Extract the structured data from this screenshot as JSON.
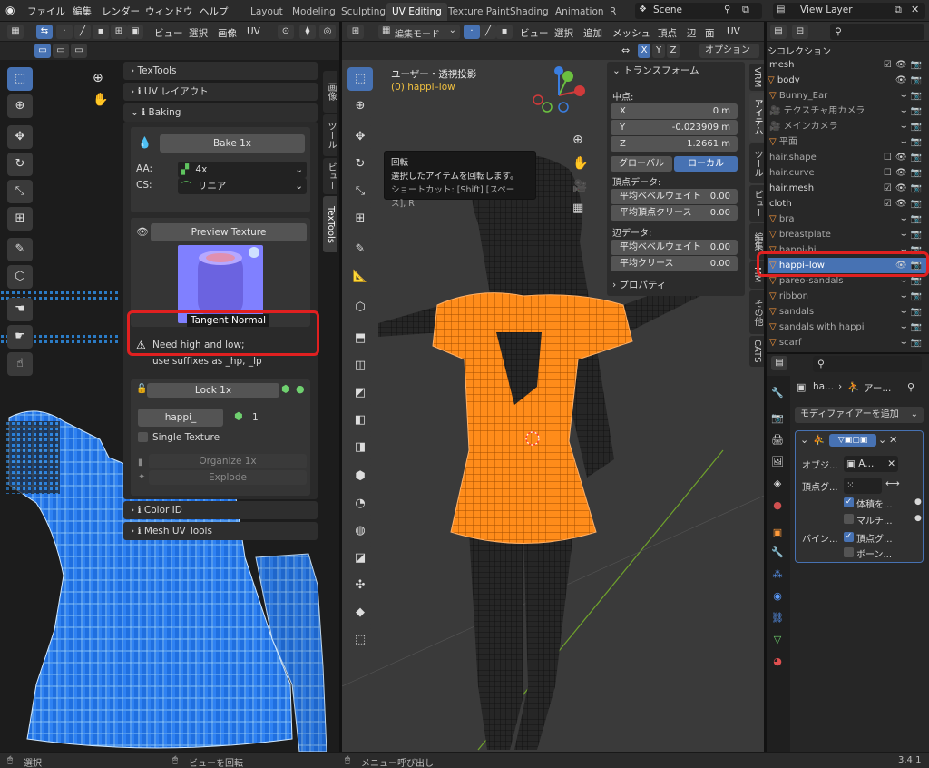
{
  "topbar": {
    "menus": [
      "ファイル",
      "編集",
      "レンダー",
      "ウィンドウ",
      "ヘルプ"
    ],
    "workspaces": [
      "Layout",
      "Modeling",
      "Sculpting",
      "UV Editing",
      "Texture Paint",
      "Shading",
      "Animation",
      "R"
    ],
    "active_workspace": "UV Editing",
    "scene": "Scene",
    "view_layer": "View Layer"
  },
  "uv_editor": {
    "header_menus": [
      "ビュー",
      "選択",
      "画像",
      "UV"
    ],
    "sidebar_tabs": [
      "画像",
      "ツール",
      "ビュー",
      "TexTools"
    ],
    "panels": {
      "textools": "TexTools",
      "uv_layout": "UV レイアウト",
      "baking": "Baking",
      "color_id": "Color ID",
      "mesh_uv_tools": "Mesh UV Tools"
    },
    "bake_button": "Bake 1x",
    "aa_label": "AA:",
    "aa_value": "4x",
    "cs_label": "CS:",
    "cs_value": "リニア",
    "preview_button": "Preview Texture",
    "preview_caption": "Tangent Normal",
    "warning_line1": "Need high and low;",
    "warning_line2": "use suffixes as _hp, _lp",
    "lock_button": "Lock 1x",
    "object_name": "happi_",
    "object_count": "1",
    "single_texture": "Single Texture",
    "organize_button": "Organize 1x",
    "explode_button": "Explode"
  },
  "viewport": {
    "mode": "編集モード",
    "header_menus": [
      "ビュー",
      "選択",
      "追加",
      "メッシュ",
      "頂点",
      "辺",
      "面",
      "UV"
    ],
    "axes": [
      "X",
      "Y",
      "Z"
    ],
    "options": "オプション",
    "view_title": "ユーザー・透視投影",
    "object_label": "(0) happi–low",
    "tooltip_title": "回転",
    "tooltip_desc": "選択したアイテムを回転します。",
    "tooltip_shortcut": "ショートカット: [Shift] [スペース], R",
    "sidebar_tabs": [
      "VRM",
      "アイテム",
      "ツール",
      "ビュー",
      "編集",
      "MM",
      "その他",
      "CATS"
    ],
    "transform": {
      "title": "トランスフォーム",
      "median": "中点:",
      "x_label": "X",
      "x_value": "0 m",
      "y_label": "Y",
      "y_value": "-0.023909 m",
      "z_label": "Z",
      "z_value": "1.2661 m",
      "global": "グローバル",
      "local": "ローカル",
      "vertex_data": "頂点データ:",
      "bevel_weight": "平均ベベルウェイト",
      "bevel_weight_value": "0.00",
      "vertex_crease": "平均頂点クリース",
      "vertex_crease_value": "0.00",
      "edge_data": "辺データ:",
      "edge_bevel_weight": "平均ベベルウェイト",
      "edge_bevel_weight_value": "0.00",
      "edge_crease": "平均クリース",
      "edge_crease_value": "0.00",
      "properties": "プロパティ"
    }
  },
  "outliner": {
    "collection": "シコレクション",
    "items": [
      "mesh",
      "body",
      "Bunny_Ear",
      "テクスチャ用カメラ",
      "メインカメラ",
      "平面",
      "hair.shape",
      "hair.curve",
      "hair.mesh",
      "cloth",
      "bra",
      "breastplate",
      "happi-hi",
      "happi–low",
      "pareo-sandals",
      "ribbon",
      "sandals",
      "sandals with happi",
      "scarf"
    ],
    "selected": "happi–low"
  },
  "properties": {
    "breadcrumb_1": "ha...",
    "breadcrumb_2": "アー...",
    "add_modifier": "モディファイアーを追加",
    "object_label": "オブジ...",
    "object_value": "A...",
    "vertex_group_label": "頂点グ...",
    "bind_label": "バイン...",
    "volume": "体積を...",
    "multi": "マルチ...",
    "vertex_group_check": "頂点グ...",
    "bone": "ボーン..."
  },
  "statusbar": {
    "select": "選択",
    "rotate_view": "ビューを回転",
    "menu_call": "メニュー呼び出し",
    "version": "3.4.1"
  },
  "colors": {
    "accent": "#4772b3",
    "highlight": "#e02020",
    "mesh_orange": "#ff8c1a",
    "uv_blue": "#1f6fe0"
  }
}
